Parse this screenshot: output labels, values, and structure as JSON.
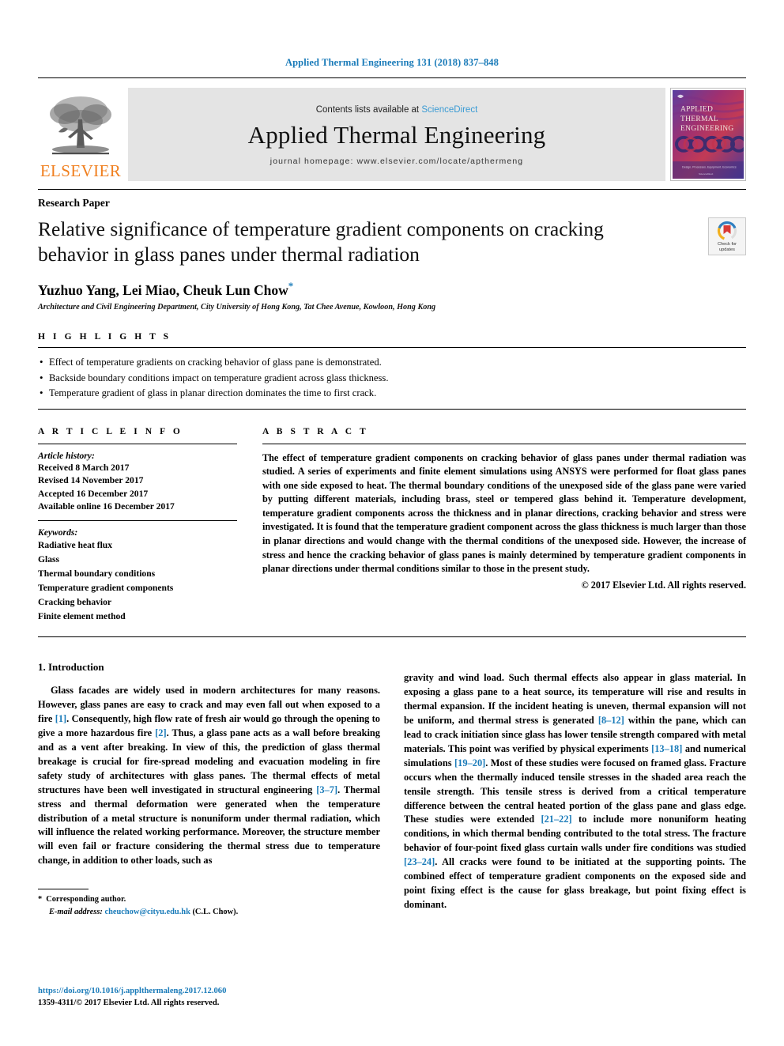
{
  "running_head": "Applied Thermal Engineering 131 (2018) 837–848",
  "masthead": {
    "publisher_name": "ELSEVIER",
    "contents_prefix": "Contents lists available at ",
    "sciencedirect": "ScienceDirect",
    "journal_title": "Applied Thermal Engineering",
    "homepage": "journal homepage: www.elsevier.com/locate/apthermeng",
    "cover": {
      "line1": "APPLIED",
      "line2": "THERMAL",
      "line3": "ENGINEERING",
      "footer": "Design, Processes, Equipment, Economics"
    }
  },
  "article": {
    "type": "Research Paper",
    "title": "Relative significance of temperature gradient components on cracking behavior in glass panes under thermal radiation",
    "authors": "Yuzhuo Yang, Lei Miao, Cheuk Lun Chow",
    "corresponding_marker": "*",
    "affiliation": "Architecture and Civil Engineering Department, City University of Hong Kong, Tat Chee Avenue, Kowloon, Hong Kong",
    "crossmark": {
      "line1": "Check for",
      "line2": "updates"
    }
  },
  "highlights": {
    "heading": "H I G H L I G H T S",
    "items": [
      "Effect of temperature gradients on cracking behavior of glass pane is demonstrated.",
      "Backside boundary conditions impact on temperature gradient across glass thickness.",
      "Temperature gradient of glass in planar direction dominates the time to first crack."
    ]
  },
  "article_info": {
    "heading": "A R T I C L E   I N F O",
    "history_label": "Article history:",
    "history": [
      "Received 8 March 2017",
      "Revised 14 November 2017",
      "Accepted 16 December 2017",
      "Available online 16 December 2017"
    ],
    "keywords_label": "Keywords:",
    "keywords": [
      "Radiative heat flux",
      "Glass",
      "Thermal boundary conditions",
      "Temperature gradient components",
      "Cracking behavior",
      "Finite element method"
    ]
  },
  "abstract": {
    "heading": "A B S T R A C T",
    "text": "The effect of temperature gradient components on cracking behavior of glass panes under thermal radiation was studied. A series of experiments and finite element simulations using ANSYS were performed for float glass panes with one side exposed to heat. The thermal boundary conditions of the unexposed side of the glass pane were varied by putting different materials, including brass, steel or tempered glass behind it. Temperature development, temperature gradient components across the thickness and in planar directions, cracking behavior and stress were investigated. It is found that the temperature gradient component across the glass thickness is much larger than those in planar directions and would change with the thermal conditions of the unexposed side. However, the increase of stress and hence the cracking behavior of glass panes is mainly determined by temperature gradient components in planar directions under thermal conditions similar to those in the present study.",
    "copyright": "© 2017 Elsevier Ltd. All rights reserved."
  },
  "introduction": {
    "heading": "1. Introduction",
    "left_column": {
      "p1_a": "Glass facades are widely used in modern architectures for many reasons. However, glass panes are easy to crack and may even fall out when exposed to a fire ",
      "c1": "[1]",
      "p1_b": ". Consequently, high flow rate of fresh air would go through the opening to give a more hazardous fire ",
      "c2": "[2]",
      "p1_c": ". Thus, a glass pane acts as a wall before breaking and as a vent after breaking. In view of this, the prediction of glass thermal breakage is crucial for fire-spread modeling and evacuation modeling in fire safety study of architectures with glass panes. The thermal effects of metal structures have been well investigated in structural engineering ",
      "c3": "[3–7]",
      "p1_d": ". Thermal stress and thermal deformation were generated when the temperature distribution of a metal structure is nonuniform under thermal radiation, which will influence the related working performance. Moreover, the structure member will even fail or fracture considering the thermal stress due to temperature change, in addition to other loads, such as"
    },
    "right_column": {
      "p2_a": "gravity and wind load. Such thermal effects also appear in glass material. In exposing a glass pane to a heat source, its temperature will rise and results in thermal expansion. If the incident heating is uneven, thermal expansion will not be uniform, and thermal stress is generated ",
      "c4": "[8–12]",
      "p2_b": " within the pane, which can lead to crack initiation since glass has lower tensile strength compared with metal materials. This point was verified by physical experiments ",
      "c5": "[13–18]",
      "p2_c": " and numerical simulations ",
      "c6": "[19–20]",
      "p2_d": ". Most of these studies were focused on framed glass. Fracture occurs when the thermally induced tensile stresses in the shaded area reach the tensile strength. This tensile stress is derived from a critical temperature difference between the central heated portion of the glass pane and glass edge. These studies were extended ",
      "c7": "[21–22]",
      "p2_e": " to include more nonuniform heating conditions, in which thermal bending contributed to the total stress. The fracture behavior of four-point fixed glass curtain walls under fire conditions was studied ",
      "c8": "[23–24]",
      "p2_f": ". All cracks were found to be initiated at the supporting points. The combined effect of temperature gradient components on the exposed side and point fixing effect is the cause for glass breakage, but point fixing effect is dominant."
    }
  },
  "footnote": {
    "star": "*",
    "corresponding": "Corresponding author.",
    "email_label": "E-mail address:",
    "email": "cheuchow@cityu.edu.hk",
    "email_suffix": " (C.L. Chow)."
  },
  "bottom": {
    "doi": "https://doi.org/10.1016/j.applthermaleng.2017.12.060",
    "issn": "1359-4311/© 2017 Elsevier Ltd. All rights reserved."
  },
  "colors": {
    "link_blue": "#1a7bb9",
    "elsevier_orange": "#f08020",
    "band_gray": "#e4e4e4"
  }
}
